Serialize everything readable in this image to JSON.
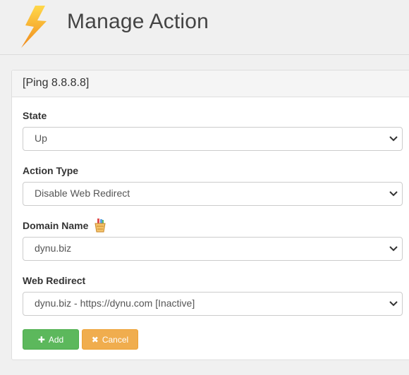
{
  "header": {
    "title": "Manage Action",
    "logo_icon": "lightning-bolt-icon"
  },
  "panel": {
    "heading": "[Ping 8.8.8.8]"
  },
  "form": {
    "state": {
      "label": "State",
      "value": "Up"
    },
    "action_type": {
      "label": "Action Type",
      "value": "Disable Web Redirect"
    },
    "domain_name": {
      "label": "Domain Name",
      "value": "dynu.biz",
      "icon": "shopping-bucket-icon"
    },
    "web_redirect": {
      "label": "Web Redirect",
      "value": "dynu.biz - https://dynu.com [Inactive]"
    }
  },
  "buttons": {
    "add": {
      "label": "Add",
      "icon": "plus-icon",
      "color": "#5cb85c"
    },
    "cancel": {
      "label": "Cancel",
      "icon": "x-icon",
      "color": "#f0ad4e"
    }
  },
  "colors": {
    "logo_yellow": "#f7c21b",
    "logo_orange": "#f08a1c"
  }
}
